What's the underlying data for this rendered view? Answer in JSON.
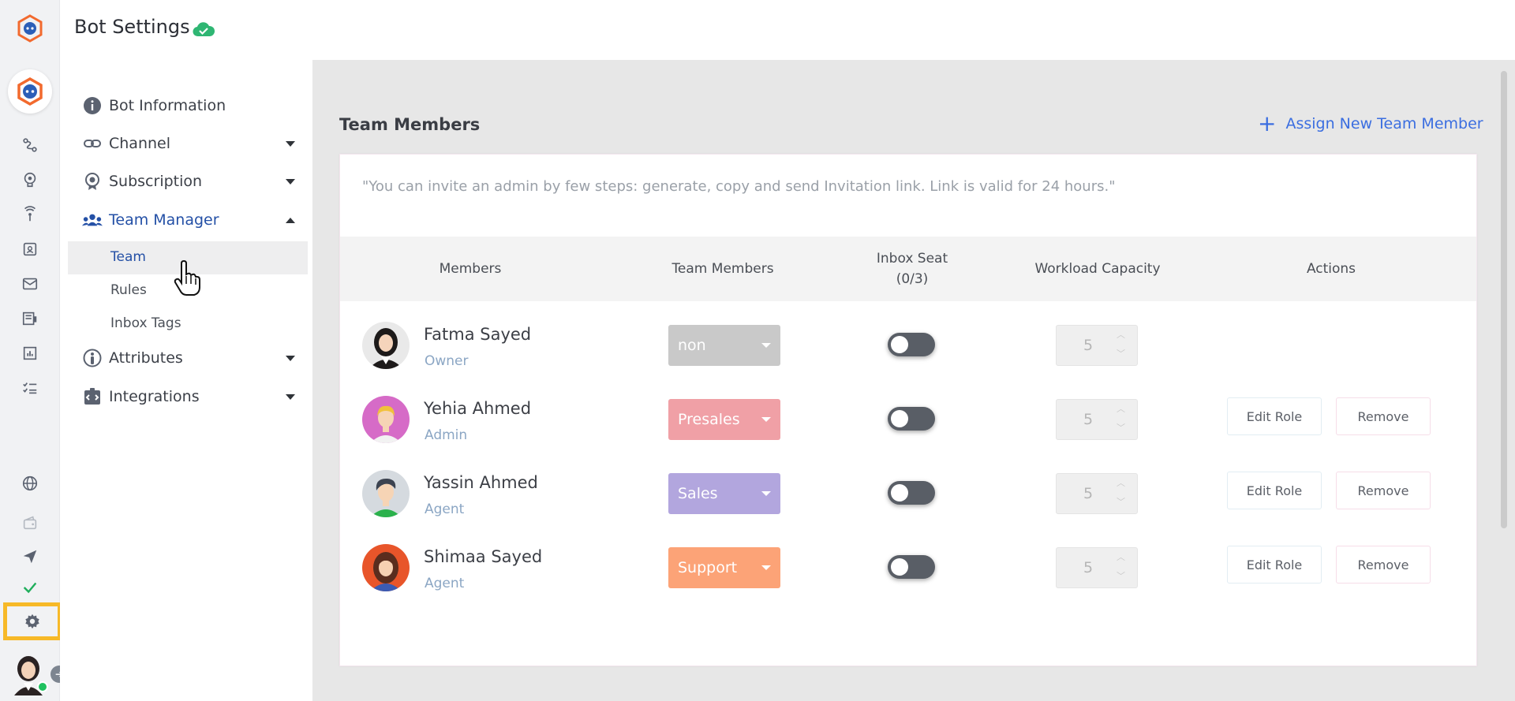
{
  "app": {
    "page_title": "Bot Settings"
  },
  "menu": {
    "items": [
      {
        "label": "Bot Information",
        "icon": "info-icon"
      },
      {
        "label": "Channel",
        "icon": "link-icon"
      },
      {
        "label": "Subscription",
        "icon": "badge-icon"
      },
      {
        "label": "Team Manager",
        "icon": "team-icon"
      },
      {
        "label": "Attributes",
        "icon": "person-circle-icon"
      },
      {
        "label": "Integrations",
        "icon": "integrations-icon"
      }
    ],
    "sub_items": [
      "Team",
      "Rules",
      "Inbox Tags"
    ]
  },
  "main": {
    "section_title": "Team Members",
    "assign_label": "Assign New Team Member",
    "hint": "\"You can invite an admin by few steps: generate, copy and send Invitation link. Link is valid for 24 hours.\"",
    "columns": {
      "members": "Members",
      "team_members": "Team Members",
      "inbox_seat_line1": "Inbox Seat",
      "inbox_seat_line2": "(0/3)",
      "workload": "Workload Capacity",
      "actions": "Actions"
    },
    "actions": {
      "edit": "Edit Role",
      "remove": "Remove"
    },
    "rows": [
      {
        "name": "Fatma Sayed",
        "role": "Owner",
        "team": "non",
        "team_color": "#c9c9c9",
        "workload": "5"
      },
      {
        "name": "Yehia Ahmed",
        "role": "Admin",
        "team": "Presales",
        "team_color": "#f0a0a6",
        "workload": "5"
      },
      {
        "name": "Yassin Ahmed",
        "role": "Agent",
        "team": "Sales",
        "team_color": "#b2a6de",
        "workload": "5"
      },
      {
        "name": "Shimaa Sayed",
        "role": "Agent",
        "team": "Support",
        "team_color": "#fca377",
        "workload": "5"
      }
    ]
  },
  "colors": {
    "accent": "#3b6ee0",
    "highlight": "#f7b928",
    "arrow": "#e01f1f"
  }
}
